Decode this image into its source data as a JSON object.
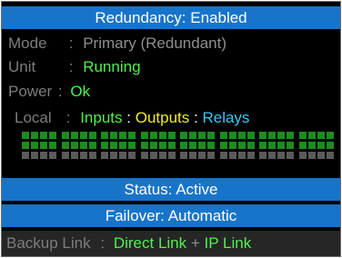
{
  "title": "Redundancy: Enabled",
  "mode": {
    "label": "Mode",
    "sep": ":",
    "value": "Primary (Redundant)"
  },
  "unit": {
    "label": "Unit",
    "sep": ":",
    "value": "Running"
  },
  "power": {
    "label": "Power",
    "sep": ":",
    "value": "Ok"
  },
  "local": {
    "label": "Local",
    "sep": ":",
    "inputs": "Inputs",
    "sep2": ":",
    "outputs": "Outputs",
    "sep3": ":",
    "relays": "Relays"
  },
  "io_grid": {
    "rows": [
      {
        "name": "inputs",
        "color": "#1e8c1e",
        "blocks": 8
      },
      {
        "name": "outputs",
        "color": "#1e8c1e",
        "blocks": 8
      },
      {
        "name": "relays",
        "color": "#5a5a5a",
        "blocks": 8
      }
    ]
  },
  "status": "Status: Active",
  "failover": "Failover: Automatic",
  "backup": {
    "label": "Backup Link",
    "sep": ":",
    "direct": "Direct Link",
    "plus": "+",
    "ip": "IP Link"
  },
  "colors": {
    "accent_blue": "#1874c8",
    "green": "#4ef24e",
    "yellow": "#f0ec2a",
    "cyan": "#3cc8f0"
  }
}
